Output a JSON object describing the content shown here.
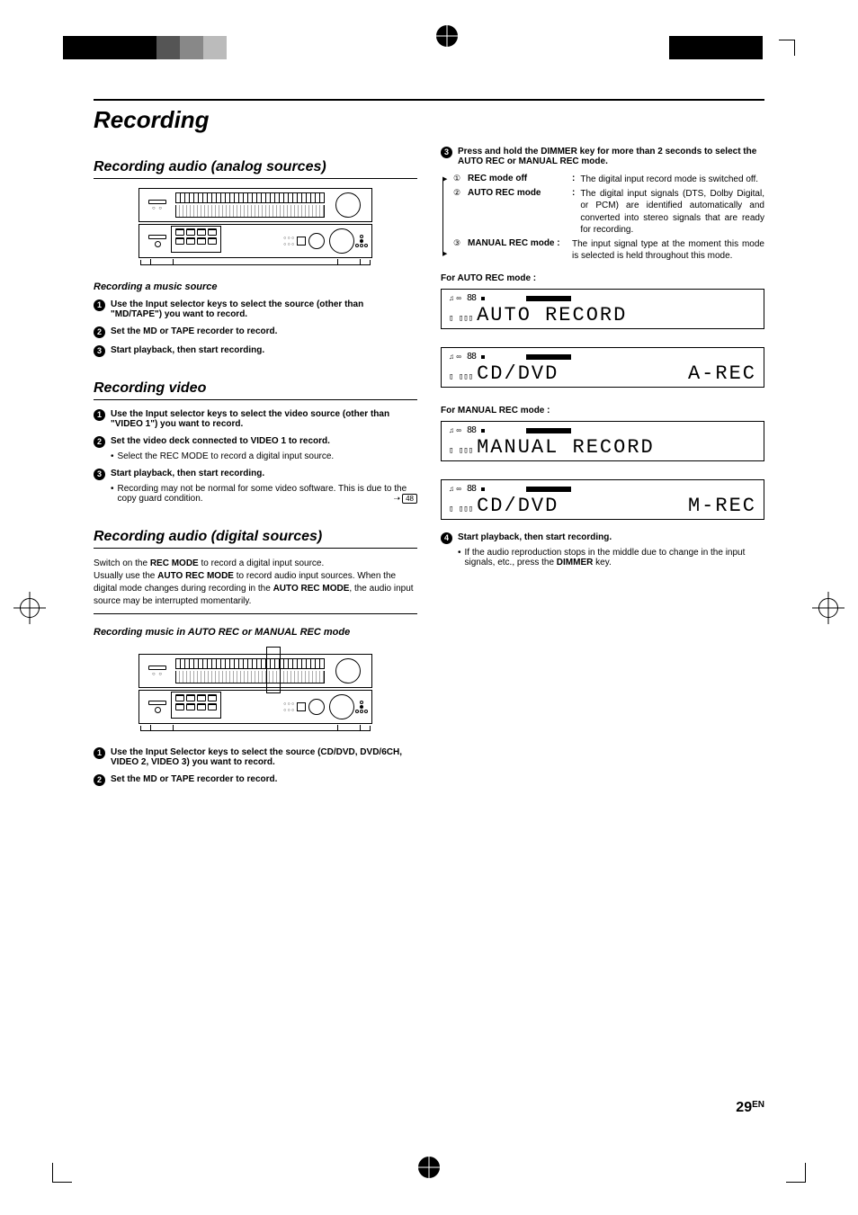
{
  "page": {
    "title": "Recording",
    "number": "29",
    "region": "EN"
  },
  "left": {
    "sec_analog": {
      "heading": "Recording audio (analog sources)",
      "music_heading": "Recording a music source",
      "steps": {
        "s1": "Use the Input selector keys to select the source (other than \"MD/TAPE\") you want to record.",
        "s2": "Set the MD or TAPE recorder to record.",
        "s3": "Start playback, then start recording."
      }
    },
    "sec_video": {
      "heading": "Recording video",
      "steps": {
        "s1": "Use the Input selector keys to select the video source (other than \"VIDEO 1\") you want to record.",
        "s2": "Set the video deck connected to VIDEO 1 to record.",
        "s2_note": "Select the REC MODE to record a digital input source.",
        "s3": "Start playback, then start recording.",
        "s3_note": "Recording may not be normal for some video software. This is due to the copy guard condition.",
        "s3_ref": "48"
      }
    },
    "sec_digital": {
      "heading": "Recording audio (digital sources)",
      "body": "Switch on the REC MODE to record a digital input source.\nUsually use the AUTO REC MODE to record audio input sources. When the digital mode changes during recording in the AUTO REC MODE, the audio input source may be interrupted momentarily.",
      "sub_heading": "Recording music in AUTO REC or MANUAL REC mode",
      "steps": {
        "s1": "Use the Input Selector keys to select the source (CD/DVD, DVD/6CH, VIDEO 2, VIDEO 3) you want to record.",
        "s2": "Set the MD or TAPE recorder to record."
      }
    }
  },
  "right": {
    "step3": "Press and hold the DIMMER key for more than 2 seconds to select the AUTO REC or MANUAL REC mode.",
    "modes": {
      "m1": {
        "num": "①",
        "label": "REC mode off",
        "desc": "The digital input record mode is switched off."
      },
      "m2": {
        "num": "②",
        "label": "AUTO REC mode",
        "desc": "The digital input signals (DTS, Dolby Digital, or PCM) are identified automatically and converted into stereo signals that are ready for recording."
      },
      "m3": {
        "num": "③",
        "label": "MANUAL REC mode",
        "desc": "The input signal type at the moment this mode is selected is held throughout this mode."
      }
    },
    "for_auto": "For AUTO REC mode :",
    "for_manual": "For MANUAL REC mode :",
    "lcd": {
      "auto1": "AUTO  RECORD",
      "auto2_l": "CD/DVD",
      "auto2_r": "A-REC",
      "manual1": "MANUAL  RECORD",
      "manual2_l": "CD/DVD",
      "manual2_r": "M-REC"
    },
    "step4": "Start playback, then start recording.",
    "step4_note": "If the audio reproduction stops in the middle due to change in the input signals, etc., press the DIMMER key."
  }
}
